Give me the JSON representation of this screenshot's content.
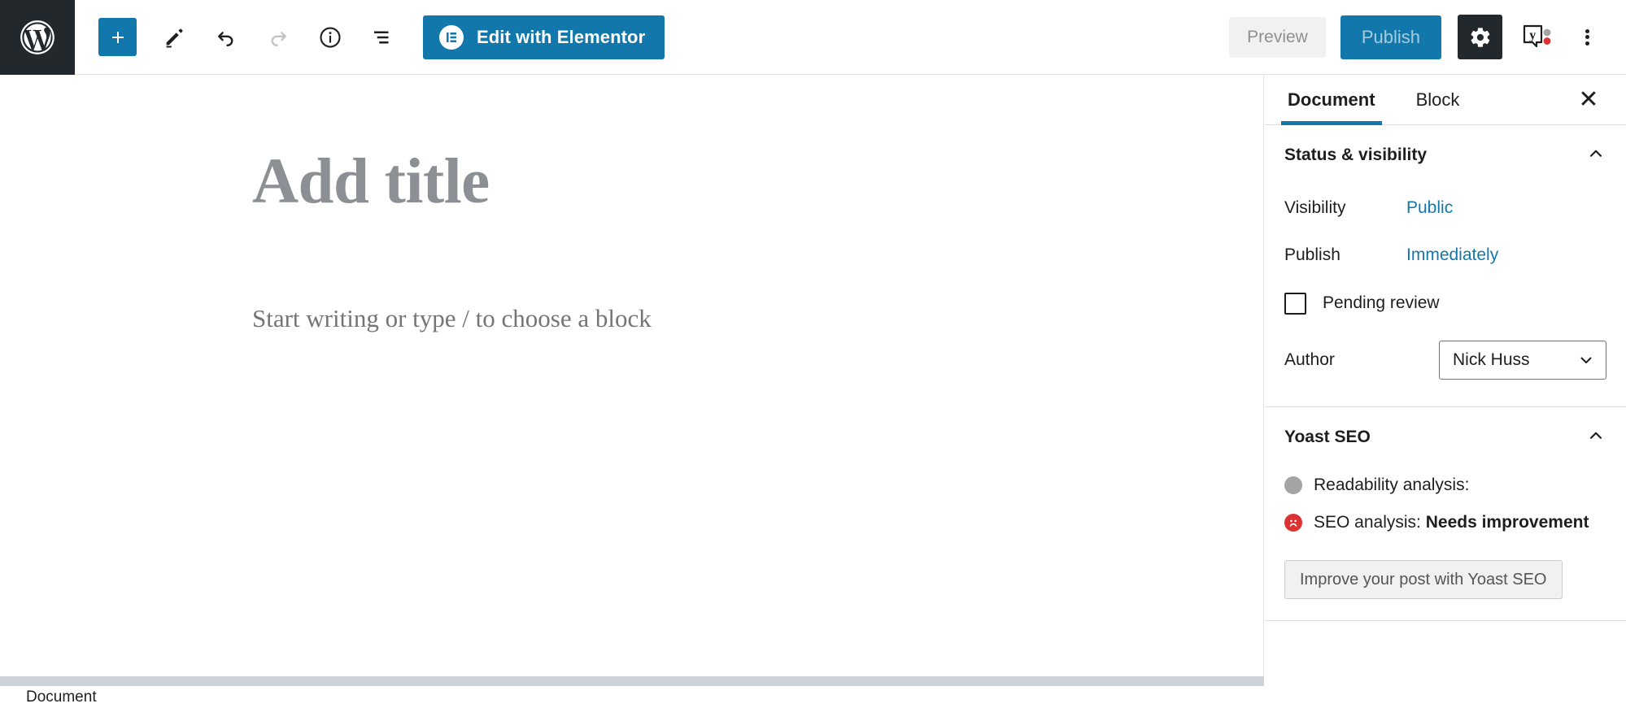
{
  "toolbar": {
    "wp_logo_name": "wordpress-logo",
    "add_block_label": "+",
    "edit_tool_name": "pen-icon",
    "undo_name": "undo-icon",
    "redo_name": "redo-icon",
    "info_name": "info-icon",
    "list_view_name": "list-view-icon",
    "elementor_label": "Edit with Elementor",
    "elementor_badge": "E",
    "preview_label": "Preview",
    "publish_label": "Publish",
    "settings_name": "gear-icon",
    "yoast_name": "yoast-seo-icon",
    "more_name": "more-options-icon"
  },
  "colors": {
    "accent_blue": "#1278ac",
    "dark": "#23282d",
    "red": "#dc3232",
    "gray_dot": "#a4a4a4",
    "placeholder_gray": "#8c8f94"
  },
  "editor": {
    "title_placeholder": "Add title",
    "paragraph_placeholder": "Start writing or type / to choose a block"
  },
  "sidebar": {
    "tabs": [
      {
        "label": "Document",
        "active": true
      },
      {
        "label": "Block",
        "active": false
      }
    ],
    "close_label": "✕",
    "status_panel": {
      "title": "Status & visibility",
      "visibility_label": "Visibility",
      "visibility_value": "Public",
      "publish_label": "Publish",
      "publish_value": "Immediately",
      "pending_review_label": "Pending review",
      "pending_review_checked": false,
      "author_label": "Author",
      "author_value": "Nick Huss"
    },
    "yoast_panel": {
      "title": "Yoast SEO",
      "readability_label": "Readability analysis:",
      "readability_value": "",
      "seo_label": "SEO analysis:",
      "seo_value": "Needs improvement",
      "improve_button": "Improve your post with Yoast SEO"
    }
  },
  "footer": {
    "breadcrumb": "Document"
  }
}
